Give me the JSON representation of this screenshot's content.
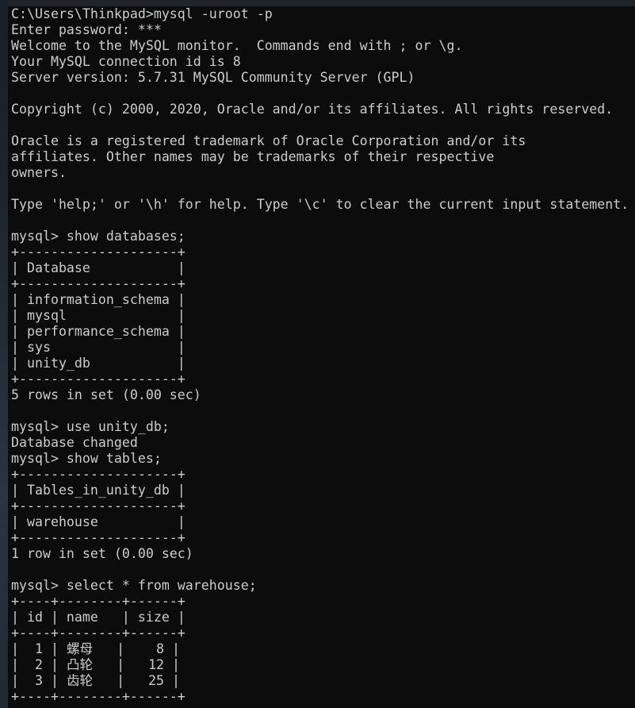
{
  "window": {
    "type": "windows-command-prompt",
    "background_color": "#0c0c0c",
    "text_color": "#cccccc",
    "desktop_color": "#1d242e",
    "top_strip_color": "#20242a"
  },
  "session": {
    "shell_prompt": "C:\\Users\\Thinkpad>",
    "command": "mysql -uroot -p",
    "password_prompt": "Enter password: ",
    "password_mask": "***"
  },
  "banner": {
    "lines": [
      "Welcome to the MySQL monitor.  Commands end with ; or \\g.",
      "Your MySQL connection id is 8",
      "Server version: 5.7.31 MySQL Community Server (GPL)",
      "",
      "Copyright (c) 2000, 2020, Oracle and/or its affiliates. All rights reserved.",
      "",
      "Oracle is a registered trademark of Oracle Corporation and/or its",
      "affiliates. Other names may be trademarks of their respective",
      "owners.",
      "",
      "Type 'help;' or '\\h' for help. Type '\\c' to clear the current input statement."
    ],
    "connection_id": "8",
    "server_version": "5.7.31",
    "server_edition": "MySQL Community Server (GPL)",
    "copyright_years": "2000, 2020"
  },
  "mysql_prompt": "mysql> ",
  "statements": [
    {
      "sql": "show databases;",
      "border": "+--------------------+",
      "header": "| Database           |",
      "rows": [
        "| information_schema |",
        "| mysql              |",
        "| performance_schema |",
        "| sys                |",
        "| unity_db           |"
      ],
      "status": "5 rows in set (0.00 sec)",
      "columns": [
        "Database"
      ],
      "data": [
        [
          "information_schema"
        ],
        [
          "mysql"
        ],
        [
          "performance_schema"
        ],
        [
          "sys"
        ],
        [
          "unity_db"
        ]
      ],
      "row_count": "5",
      "elapsed": "0.00 sec"
    },
    {
      "sql": "use unity_db;",
      "status": "Database changed"
    },
    {
      "sql": "show tables;",
      "border": "+--------------------+",
      "header": "| Tables_in_unity_db |",
      "rows": [
        "| warehouse          |"
      ],
      "status": "1 row in set (0.00 sec)",
      "columns": [
        "Tables_in_unity_db"
      ],
      "data": [
        [
          "warehouse"
        ]
      ],
      "row_count": "1",
      "elapsed": "0.00 sec"
    },
    {
      "sql": "select * from warehouse;",
      "border": "+----+--------+------+",
      "header": "| id | name   | size |",
      "columns": [
        "id",
        "name",
        "size"
      ],
      "data": [
        [
          "1",
          "螺母",
          "8"
        ],
        [
          "2",
          "凸轮",
          "12"
        ],
        [
          "3",
          "齿轮",
          "25"
        ]
      ]
    }
  ],
  "terminal_text": {
    "block_1": "C:\\Users\\Thinkpad>mysql -uroot -p\nEnter password: ***\nWelcome to the MySQL monitor.  Commands end with ; or \\g.\nYour MySQL connection id is 8\nServer version: 5.7.31 MySQL Community Server (GPL)\n\nCopyright (c) 2000, 2020, Oracle and/or its affiliates. All rights reserved.\n\nOracle is a registered trademark of Oracle Corporation and/or its\naffiliates. Other names may be trademarks of their respective\nowners.\n\nType 'help;' or '\\h' for help. Type '\\c' to clear the current input statement.\n\nmysql> show databases;\n+--------------------+\n| Database           |\n+--------------------+\n| information_schema |\n| mysql              |\n| performance_schema |\n| sys                |\n| unity_db           |\n+--------------------+\n5 rows in set (0.00 sec)\n\nmysql> use unity_db;\nDatabase changed\nmysql> show tables;\n+--------------------+\n| Tables_in_unity_db |\n+--------------------+\n| warehouse          |\n+--------------------+\n1 row in set (0.00 sec)\n\nmysql> select * from warehouse;\n+----+--------+------+\n| id | name   | size |\n+----+--------+------+\n",
    "row_1_pre": "|  1 | ",
    "row_1_cjk": "螺母",
    "row_1_post": "   |    8 |",
    "row_2_pre": "|  2 | ",
    "row_2_cjk": "凸轮",
    "row_2_post": "   |   12 |",
    "row_3_pre": "|  3 | ",
    "row_3_cjk": "齿轮",
    "row_3_post": "   |   25 |",
    "block_end": "\n+----+--------+------+"
  }
}
